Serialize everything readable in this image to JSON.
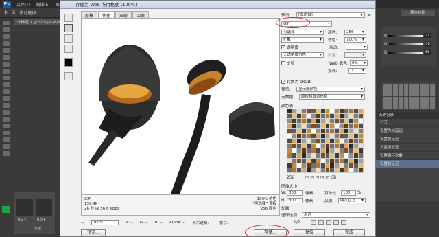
{
  "ps": {
    "logo": "Ps",
    "menu": [
      "文件(F)",
      "编辑(E)",
      "图像"
    ],
    "options_label": "自动选择:",
    "doc_tab": "未标题-1 @ 50%(RGB/8)",
    "workspace": "基本功能",
    "slider_values": [
      "21",
      "38",
      "68"
    ],
    "history_title": "历史记录",
    "history_items": [
      "打开",
      "设置为帧延迟",
      "设置帧延迟",
      "设置帧延迟",
      "设置循环次数",
      "设置帧延迟"
    ],
    "thumb_labels": [
      "0.2 ▾",
      "0.5 ▾"
    ],
    "loop_label": "永远"
  },
  "dialog": {
    "title": "存储为 Web 所用格式 (100%)",
    "tabs": [
      "原稿",
      "优化",
      "双联",
      "四联"
    ],
    "preview_info": {
      "format": "GIF",
      "size": "139.4K",
      "time": "26 秒 @ 56.6 Kbps",
      "dither_pct": "100% 仿色",
      "palette": "“可选择” 调板",
      "colors": "256 颜色"
    },
    "status": {
      "zoom": "100%",
      "r": "R: --",
      "g": "G: --",
      "b": "B: --",
      "alpha": "Alpha: --",
      "hex": "十六进制: --",
      "index": "索引: --"
    },
    "buttons": {
      "preview": "预览...",
      "save": "存储...",
      "reset": "复位",
      "done": "完成"
    }
  },
  "settings": {
    "preset_label": "预设:",
    "preset_value": "[未命名]",
    "format_value": "GIF",
    "reduction_value": "可选择",
    "colors_label": "颜色:",
    "colors_value": "256",
    "dither_value": "扩散",
    "dither_label": "仿色:",
    "dither_pct": "100%",
    "transparency_label": "透明度",
    "matte_label": "杂边:",
    "trans_dither_value": "无透明度仿色",
    "amount_label": "数量:",
    "interlaced_label": "交错",
    "websnap_label": "Web 靠色:",
    "websnap_value": "0%",
    "lossy_label": "损耗:",
    "lossy_value": "0",
    "convert_srgb": "转换为 sRGB",
    "preview_label": "预览:",
    "preview_value": "显示器颜色",
    "metadata_label": "元数据:",
    "metadata_value": "版权和联系信息",
    "color_table_label": "颜色表",
    "color_count": "256",
    "image_size_label": "图像大小",
    "w_label": "W:",
    "w_value": "800",
    "h_label": "H:",
    "h_value": "800",
    "px": "像素",
    "percent_label": "百分比:",
    "percent_value": "100",
    "quality_label": "品质:",
    "quality_value": "两次立方",
    "animation_label": "动画",
    "loop_label": "循环选项:",
    "loop_value": "永远",
    "frame": "1/2"
  }
}
